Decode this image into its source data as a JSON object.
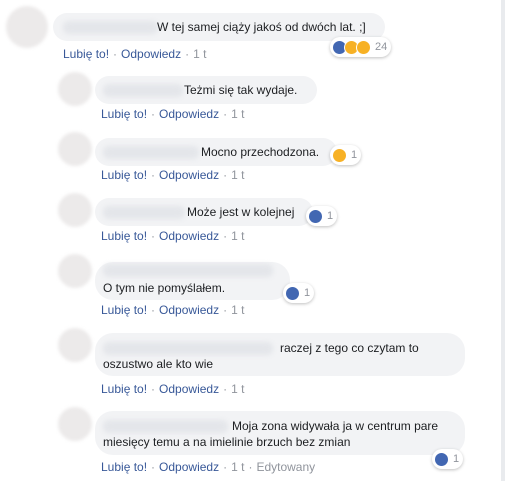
{
  "actions": {
    "like": "Lubię to!",
    "reply": "Odpowiedz",
    "time": "1 t",
    "edited": "Edytowany"
  },
  "comments": [
    {
      "text": "W tej samej ciąży jakoś od dwóch lat. ;]",
      "reactions": [
        "like-icon",
        "haha-icon",
        "wow-icon"
      ],
      "count": "24"
    },
    {
      "text": "Teżmi się tak wydaje.",
      "reactions": [],
      "count": ""
    },
    {
      "text": "Mocno przechodzona.",
      "reactions": [
        "haha-icon"
      ],
      "count": "1"
    },
    {
      "text": "Może jest w kolejnej",
      "reactions": [
        "like-icon"
      ],
      "count": "1"
    },
    {
      "text": "O tym nie pomyślałem.",
      "reactions": [
        "like-icon"
      ],
      "count": "1"
    },
    {
      "text_line1": "raczej z tego co czytam to",
      "text_line2": "oszustwo ale kto wie",
      "reactions": [],
      "count": ""
    },
    {
      "text_line1": "Moja zona widywała ja w centrum pare",
      "text_line2": "miesięcy temu a na imielinie brzuch bez zmian",
      "reactions": [
        "like-icon"
      ],
      "count": "1",
      "edited": true
    }
  ],
  "colors": {
    "link": "#385898",
    "bubble": "#f2f3f5",
    "meta": "#90949c",
    "like": "#4267b2",
    "haha": "#f7b125"
  }
}
